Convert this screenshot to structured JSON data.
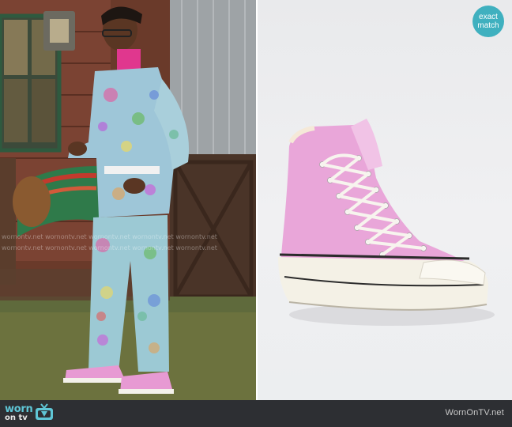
{
  "badge": {
    "line1": "exact",
    "line2": "match"
  },
  "footer": {
    "logo_line1": "worn",
    "logo_line2": "on tv",
    "site_name": "WornOnTV.net"
  },
  "watermark": {
    "text": "wornontv.net"
  },
  "icons": {
    "tv": "tv-icon"
  },
  "colors": {
    "badge": "#3fb0bf",
    "footer_bar": "#2d2f33",
    "logo_accent": "#5fc6d6",
    "sneaker": "#e9a6d9"
  }
}
